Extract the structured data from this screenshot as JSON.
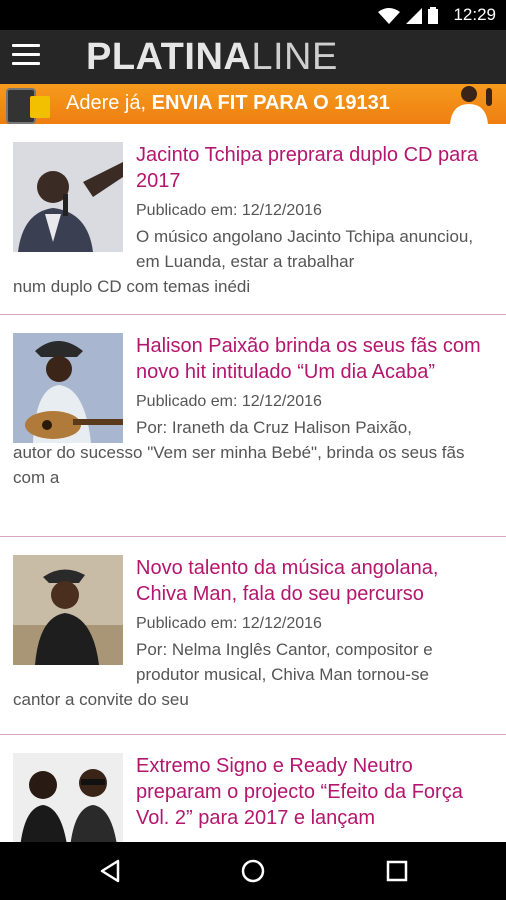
{
  "status": {
    "time": "12:29"
  },
  "appbar": {
    "logo_bold": "PLATINA",
    "logo_light": "LINE"
  },
  "banner": {
    "prefix": "Adere já, ",
    "main": "ENVIA FIT PARA O 19131"
  },
  "articles": [
    {
      "title": "Jacinto Tchipa preprara duplo CD para 2017",
      "date": "Publicado em: 12/12/2016",
      "excerpt_first": "O músico angolano Jacinto Tchipa anunciou, em Luanda, estar a trabalhar",
      "excerpt_rest": "num duplo CD com temas inédi"
    },
    {
      "title": "Halison Paixão brinda os seus fãs com novo hit intitulado “Um dia Acaba”",
      "date": "Publicado em: 12/12/2016",
      "excerpt_first": "Por: Iraneth da Cruz Halison Paixão,",
      "excerpt_rest": "autor do sucesso \"Vem ser minha Bebé\", brinda os seus fãs com a"
    },
    {
      "title": "Novo talento da música angolana, Chiva Man, fala do seu percurso",
      "date": "Publicado em: 12/12/2016",
      "excerpt_first": "Por: Nelma Inglês Cantor, compositor e produtor musical, Chiva Man tornou-se",
      "excerpt_rest": "cantor a convite do seu"
    },
    {
      "title": "Extremo Signo e Ready Neutro preparam o projecto “Efeito da Força Vol. 2” para 2017 e lançam",
      "date": "",
      "excerpt_first": "",
      "excerpt_rest": ""
    }
  ],
  "colors": {
    "accent": "#b4166e",
    "appbar": "#262626",
    "banner": "#f08a16"
  },
  "icons": {
    "menu": "hamburger-menu-icon",
    "back": "back-triangle-icon",
    "home": "home-circle-icon",
    "recents": "recents-square-icon"
  }
}
